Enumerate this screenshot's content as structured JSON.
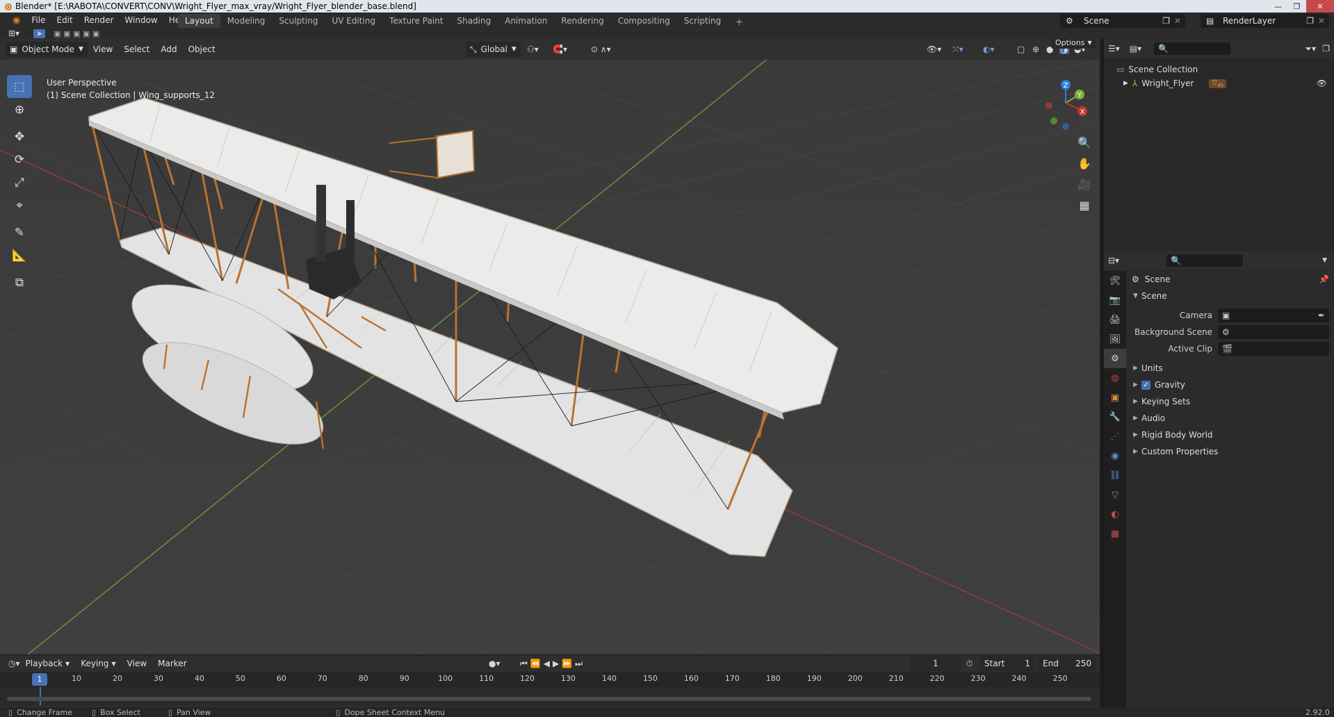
{
  "window": {
    "title": "Blender* [E:\\RABOTA\\CONVERT\\CONV\\Wright_Flyer_max_vray/Wright_Flyer_blender_base.blend]"
  },
  "menu": [
    "File",
    "Edit",
    "Render",
    "Window",
    "Help"
  ],
  "workspaces": [
    "Layout",
    "Modeling",
    "Sculpting",
    "UV Editing",
    "Texture Paint",
    "Shading",
    "Animation",
    "Rendering",
    "Compositing",
    "Scripting"
  ],
  "active_workspace": "Layout",
  "scene_selector": "Scene",
  "render_layer": "RenderLayer",
  "viewport": {
    "mode": "Object Mode",
    "menus": [
      "View",
      "Select",
      "Add",
      "Object"
    ],
    "transform_orientation": "Global",
    "options_label": "Options",
    "info_line1": "User Perspective",
    "info_line2": "(1) Scene Collection | Wing_supports_12",
    "gizmo": {
      "z": "Z",
      "y": "Y",
      "x": "X"
    }
  },
  "outliner": {
    "collection": "Scene Collection",
    "items": [
      {
        "label": "Wright_Flyer",
        "badge": "45"
      }
    ]
  },
  "properties": {
    "context": "Scene",
    "panel_title": "Scene",
    "fields": [
      {
        "label": "Camera",
        "value": ""
      },
      {
        "label": "Background Scene",
        "value": ""
      },
      {
        "label": "Active Clip",
        "value": ""
      }
    ],
    "sections": [
      "Units",
      "Gravity",
      "Keying Sets",
      "Audio",
      "Rigid Body World",
      "Custom Properties"
    ],
    "gravity_checked": true
  },
  "timeline": {
    "menus": [
      "Playback",
      "Keying",
      "View",
      "Marker"
    ],
    "current_frame": "1",
    "start_label": "Start",
    "start": "1",
    "end_label": "End",
    "end": "250",
    "ticks": [
      "1",
      "10",
      "20",
      "30",
      "40",
      "50",
      "60",
      "70",
      "80",
      "90",
      "100",
      "110",
      "120",
      "130",
      "140",
      "150",
      "160",
      "170",
      "180",
      "190",
      "200",
      "210",
      "220",
      "230",
      "240",
      "250"
    ]
  },
  "statusbar": {
    "items": [
      "Change Frame",
      "Box Select",
      "Pan View",
      "Dope Sheet Context Menu"
    ],
    "version": "2.92.0"
  },
  "colors": {
    "accent": "#4772b3",
    "x_axis": "#c0392b",
    "y_axis": "#7fb03a",
    "z_axis": "#2f7fd8",
    "wing": "#e6e6e6",
    "strut": "#b8732f"
  }
}
